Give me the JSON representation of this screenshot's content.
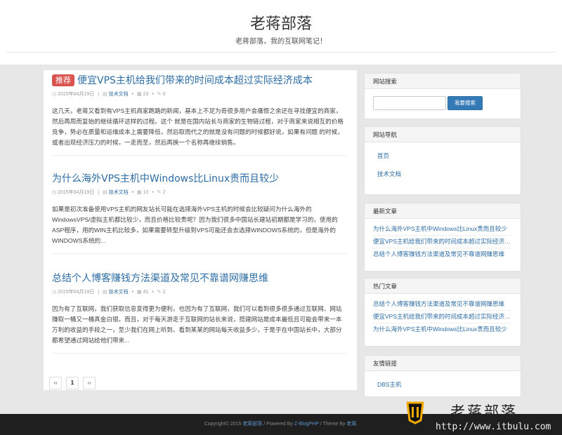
{
  "header": {
    "site_title": "老蒋部落",
    "site_subtitle": "老蒋部落，我的互联网笔记！"
  },
  "posts": [
    {
      "badge": "推荐",
      "title": "便宜VPS主机给我们带来的时间成本超过实际经济成本",
      "date": "2015年04月19日",
      "category": "技术文档",
      "views": "23",
      "comments": "0",
      "excerpt": "这几天，老蒋又看到有VPS主机商家跑路的新闻，基本上不足为奇很多用户会痛恨之余还在寻找便宜的商家，然后再周而复始的继续循环这样的过程。这个 就是在国内站长与商家的生物链过程，对于商家来说相互的价格竞争，势必在质量和运维成本上需要降低，然后取而代之的就是没有问题的时候都好说，如果有问题 的时候，或者出现经济压力的时候，一走而至，然后再换一个名称再继续销售。"
    },
    {
      "badge": "",
      "title": "为什么海外VPS主机中Windows比Linux贵而且较少",
      "date": "2015年04月19日",
      "category": "技术文档",
      "views": "10",
      "comments": "2",
      "excerpt": "如果是初次准备使用VPS主机的网友站长可能在选择海外VPS主机的时候会比较疑问为什么海外的WindowsVPS/虚拟主机都比较少，而且价格比较贵呢？因为我们很多中国站长建站初期都是学习的，使用的ASP程序，用的WIN主机比较多，如果需要转型升级到VPS可能还会去选择WINDOWS系统的，但是海外的WINDOWS系统的..."
    },
    {
      "badge": "",
      "title": "总结个人博客赚钱方法渠道及常见不靠谱网赚思维",
      "date": "2015年04月19日",
      "category": "技术文档",
      "views": "41",
      "comments": "2",
      "excerpt": "因为有了互联网，我们获取信息变得更为便利，也因为有了互联网，我们可以看到很多很多通过互联网、网站赚取一桶又一桶真金白银。而且，对于每天游走于互联网的站长来说，搭建网站是成本最低且可能会带来一本万利的收益的手段之一，至少我们在网上听到、看到某某的网站每天收益多少，于是乎在中国站长中，大部分都希望通过网站给他们带来..."
    }
  ],
  "pager": {
    "prev": "‹‹",
    "current": "1",
    "next": "››"
  },
  "sidebar": {
    "search": {
      "title": "网站搜索",
      "placeholder": "",
      "button": "我要搜索"
    },
    "nav": {
      "title": "网站导航",
      "items": [
        "首页",
        "技术文档"
      ]
    },
    "latest": {
      "title": "最新文章",
      "items": [
        "为什么海外VPS主机中Windows比Linux贵而且较少",
        "便宜VPS主机给我们带来的时间成本超过实际经济成本",
        "总结个人博客赚钱方法渠道及常见不靠谱网赚思维"
      ]
    },
    "hot": {
      "title": "热门文章",
      "items": [
        "总结个人博客赚钱方法渠道及常见不靠谱网赚思维",
        "便宜VPS主机给我们带来的时间成本超过实际经济成本",
        "为什么海外VPS主机中Windows比Linux贵而且较少"
      ]
    },
    "links": {
      "title": "友情链接",
      "items": [
        "DBS主机"
      ]
    }
  },
  "footer": {
    "copyright": "Copyright© 2015",
    "site_link": "老蒋部落",
    "powered_prefix": "/ Powered By",
    "powered_link": "Z-BlogPHP",
    "theme_prefix": "/ Theme By",
    "theme_link": "老蒋",
    "end": "."
  },
  "watermark": {
    "name": "老蒋部落",
    "url": "http://www.itbulu.com"
  },
  "icons": {
    "calendar": "calendar-icon",
    "folder": "folder-icon",
    "views": "views-icon",
    "comments": "pencil-icon"
  },
  "colors": {
    "accent": "#337ab7",
    "badge": "#d9534f",
    "footer_bg": "#1f1f1f",
    "page_bg": "#e7e7e7"
  }
}
